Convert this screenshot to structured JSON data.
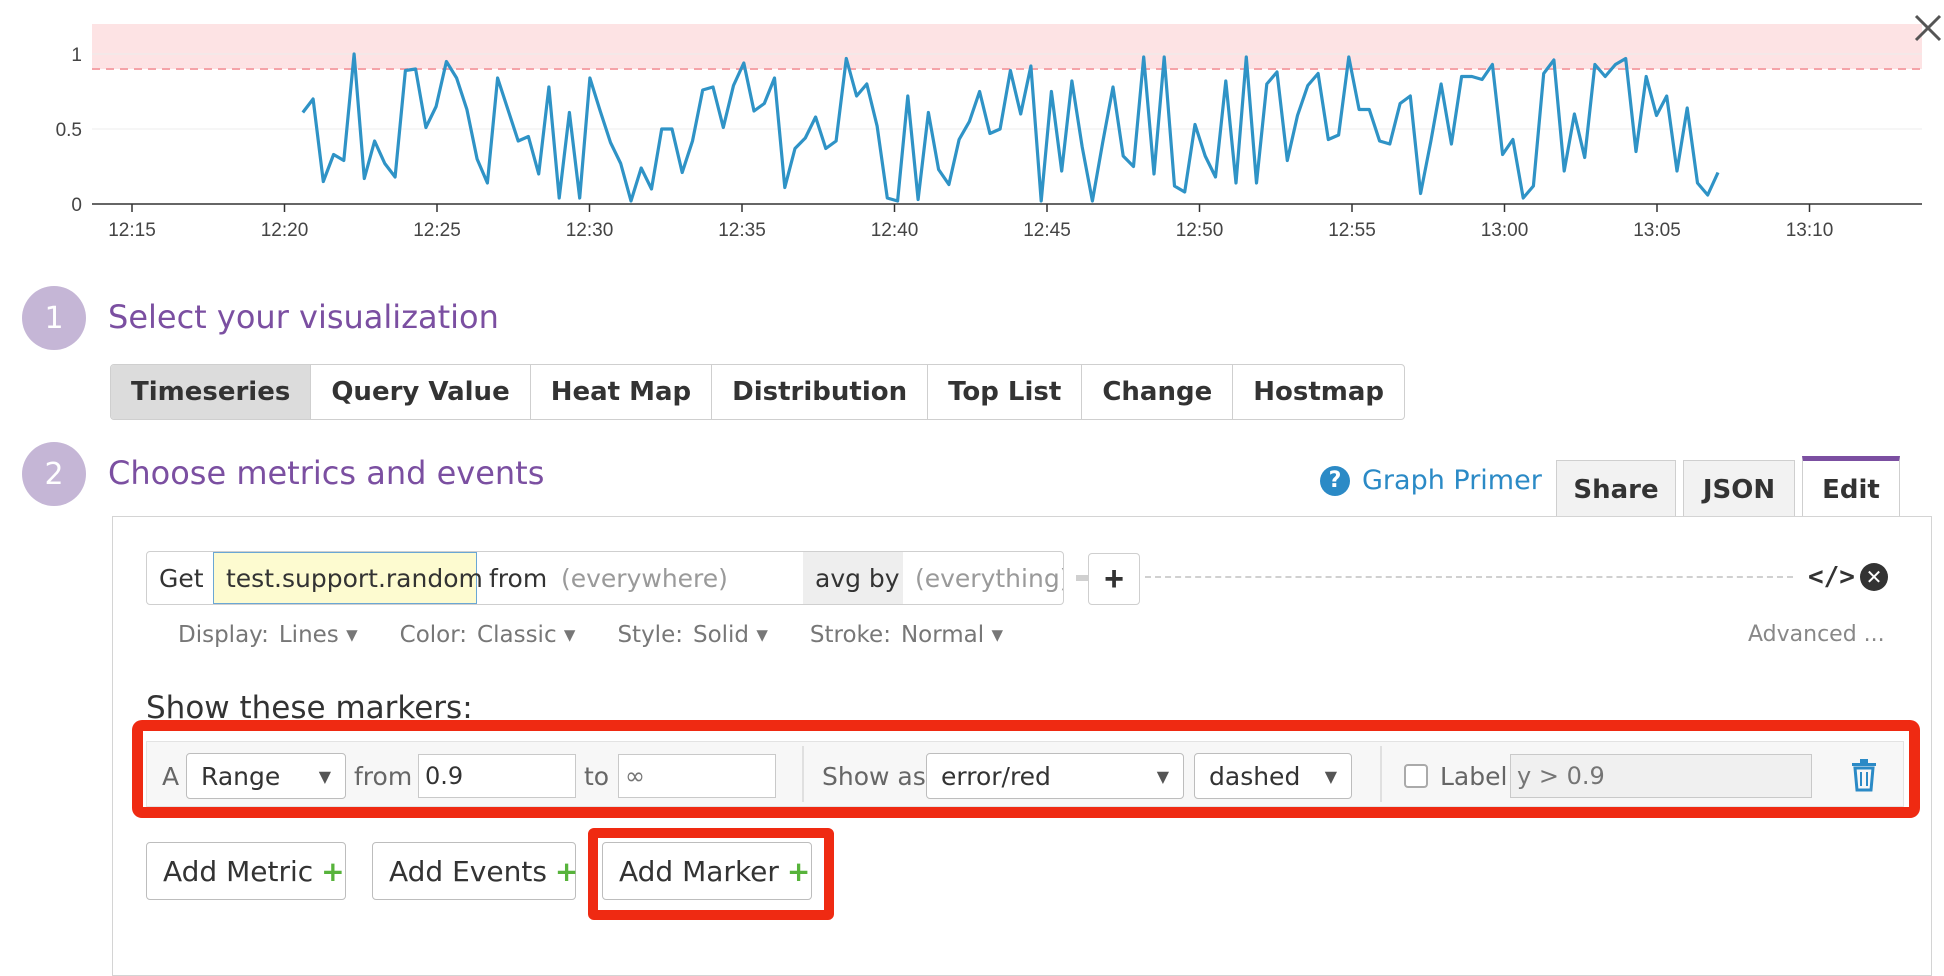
{
  "chart_data": {
    "type": "line",
    "y_ticks": [
      "1",
      "0.5",
      "0"
    ],
    "x_ticks": [
      "12:15",
      "12:20",
      "12:25",
      "12:30",
      "12:35",
      "12:40",
      "12:45",
      "12:50",
      "12:55",
      "13:00",
      "13:05",
      "13:10"
    ],
    "ylim": [
      0,
      1.2
    ],
    "marker_range": {
      "from": 0.9,
      "to": "∞",
      "style": "dashed",
      "color": "#f5a3a8"
    },
    "line_color": "#2f93c6",
    "series": [
      {
        "values": [
          0.61,
          0.7,
          0.15,
          0.33,
          0.29,
          1.0,
          0.17,
          0.42,
          0.27,
          0.18,
          0.89,
          0.9,
          0.51,
          0.65,
          0.95,
          0.84,
          0.63,
          0.3,
          0.14,
          0.84,
          0.63,
          0.42,
          0.45,
          0.2,
          0.78,
          0.04,
          0.61,
          0.04,
          0.84,
          0.62,
          0.41,
          0.27,
          0.02,
          0.24,
          0.1,
          0.5,
          0.5,
          0.21,
          0.42,
          0.76,
          0.78,
          0.51,
          0.79,
          0.94,
          0.62,
          0.67,
          0.84,
          0.11,
          0.37,
          0.44,
          0.58,
          0.37,
          0.42,
          0.97,
          0.72,
          0.8,
          0.52,
          0.04,
          0.02,
          0.72,
          0.03,
          0.61,
          0.23,
          0.13,
          0.43,
          0.55,
          0.75,
          0.47,
          0.5,
          0.89,
          0.6,
          0.92,
          0.02,
          0.75,
          0.22,
          0.82,
          0.38,
          0.02,
          0.41,
          0.78,
          0.32,
          0.25,
          0.98,
          0.2,
          0.98,
          0.12,
          0.08,
          0.53,
          0.32,
          0.18,
          0.82,
          0.14,
          0.98,
          0.14,
          0.8,
          0.88,
          0.29,
          0.59,
          0.79,
          0.87,
          0.43,
          0.46,
          0.98,
          0.63,
          0.63,
          0.42,
          0.4,
          0.67,
          0.72,
          0.07,
          0.42,
          0.8,
          0.4,
          0.85,
          0.85,
          0.83,
          0.93,
          0.33,
          0.43,
          0.04,
          0.12,
          0.87,
          0.96,
          0.22,
          0.6,
          0.31,
          0.93,
          0.85,
          0.93,
          0.97,
          0.35,
          0.85,
          0.59,
          0.72,
          0.22,
          0.64,
          0.14,
          0.06,
          0.21
        ]
      }
    ],
    "x_start_minutes": 5.6,
    "x_end_minutes": 52.0,
    "x_range_minutes": [
      0,
      57.6
    ]
  },
  "window": {
    "close_icon": "close-icon"
  },
  "step1": {
    "number": "1",
    "title": "Select your visualization"
  },
  "viz_tabs": [
    "Timeseries",
    "Query Value",
    "Heat Map",
    "Distribution",
    "Top List",
    "Change",
    "Hostmap"
  ],
  "step2": {
    "number": "2",
    "title": "Choose metrics and events"
  },
  "primer": {
    "icon": "?",
    "label": "Graph Primer"
  },
  "right_tabs": {
    "share": "Share",
    "json": "JSON",
    "edit": "Edit"
  },
  "query": {
    "get": "Get",
    "metric": "test.support.random",
    "from": "from",
    "from_value": "(everywhere)",
    "agg": "avg by",
    "by_value": "(everything)",
    "add": "+",
    "code_icon": "</>",
    "remove_icon": "✕"
  },
  "display": {
    "display_label": "Display:",
    "display_value": "Lines ▾",
    "color_label": "Color:",
    "color_value": "Classic ▾",
    "style_label": "Style:",
    "style_value": "Solid ▾",
    "stroke_label": "Stroke:",
    "stroke_value": "Normal ▾",
    "advanced": "Advanced ..."
  },
  "markers": {
    "title": "Show these markers:",
    "row": {
      "letter": "A",
      "type": "Range",
      "from_label": "from",
      "from_value": "0.9",
      "to_label": "to",
      "to_placeholder": "∞",
      "show_as_label": "Show as",
      "show_as_value": "error/red",
      "line_style": "dashed",
      "label_label": "Label",
      "label_placeholder": "y > 0.9",
      "caret": "▼"
    }
  },
  "buttons": {
    "add_metric": "Add Metric",
    "add_events": "Add Events",
    "add_marker": "Add Marker",
    "plus": "+"
  },
  "colors": {
    "accent": "#7b4fa1",
    "link": "#2b8ac6",
    "highlight": "#ef2a12",
    "plus": "#57b33b"
  }
}
